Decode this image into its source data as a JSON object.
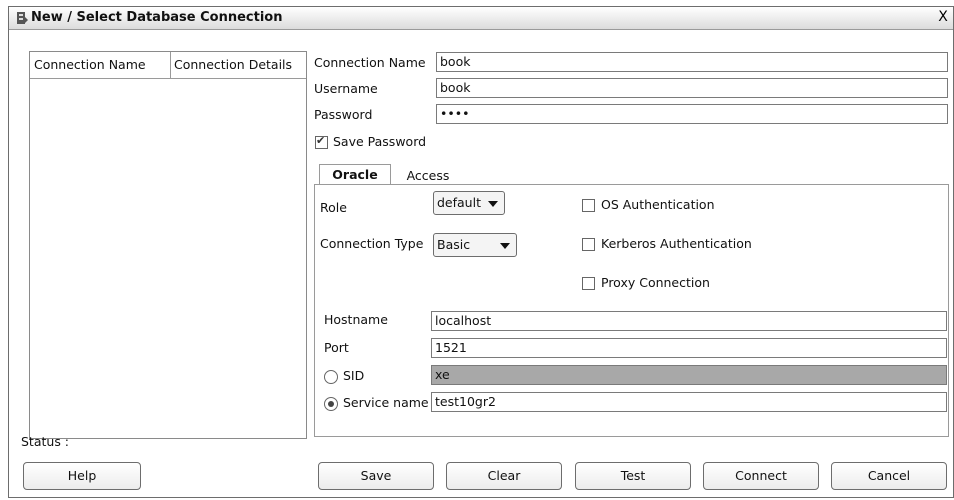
{
  "window": {
    "title": "New / Select Database Connection",
    "close": "X"
  },
  "list": {
    "headers": [
      "Connection Name",
      "Connection Details"
    ]
  },
  "form": {
    "connection_name_label": "Connection Name",
    "connection_name_value": "book",
    "username_label": "Username",
    "username_value": "book",
    "password_label": "Password",
    "password_value": "••••",
    "save_password_label": "Save Password",
    "save_password_checked": true
  },
  "tabs": [
    {
      "label": "Oracle",
      "active": true
    },
    {
      "label": "Access",
      "active": false
    }
  ],
  "oracle": {
    "role_label": "Role",
    "role_value": "default",
    "connection_type_label": "Connection Type",
    "connection_type_value": "Basic",
    "os_auth_label": "OS Authentication",
    "kerberos_label": "Kerberos Authentication",
    "proxy_label": "Proxy Connection",
    "hostname_label": "Hostname",
    "hostname_value": "localhost",
    "port_label": "Port",
    "port_value": "1521",
    "sid_label": "SID",
    "sid_value": "xe",
    "service_label": "Service name",
    "service_value": "test10gr2"
  },
  "status": "Status :",
  "buttons": {
    "help": "Help",
    "save": "Save",
    "clear": "Clear",
    "test": "Test",
    "connect": "Connect",
    "cancel": "Cancel"
  }
}
